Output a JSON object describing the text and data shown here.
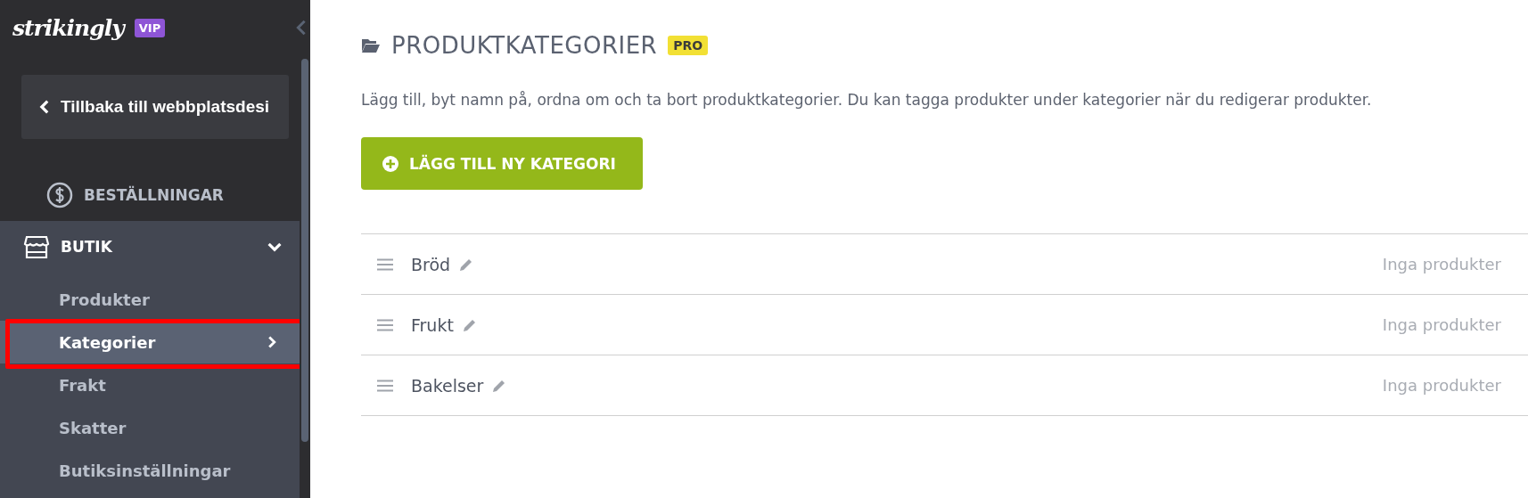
{
  "sidebar": {
    "logo": "strikingly",
    "badge": "VIP",
    "back_button": "Tillbaka till webbplatsdesi",
    "sections": [
      {
        "kind": "orders",
        "label": "BESTÄLLNINGAR",
        "expanded": false
      },
      {
        "kind": "store",
        "label": "BUTIK",
        "expanded": true,
        "children": [
          {
            "label": "Produkter",
            "selected": false,
            "highlighted": false
          },
          {
            "label": "Kategorier",
            "selected": true,
            "highlighted": true
          },
          {
            "label": "Frakt",
            "selected": false,
            "highlighted": false
          },
          {
            "label": "Skatter",
            "selected": false,
            "highlighted": false
          },
          {
            "label": "Butiksinställningar",
            "selected": false,
            "highlighted": false
          }
        ]
      }
    ]
  },
  "main": {
    "title": "PRODUKTKATEGORIER",
    "badge": "PRO",
    "description": "Lägg till, byt namn på, ordna om och ta bort produktkategorier. Du kan tagga produkter under kategorier när du redigerar produkter.",
    "add_button": "LÄGG TILL NY KATEGORI",
    "categories": [
      {
        "name": "Bröd",
        "count": "Inga produkter"
      },
      {
        "name": "Frukt",
        "count": "Inga produkter"
      },
      {
        "name": "Bakelser",
        "count": "Inga produkter"
      }
    ]
  }
}
